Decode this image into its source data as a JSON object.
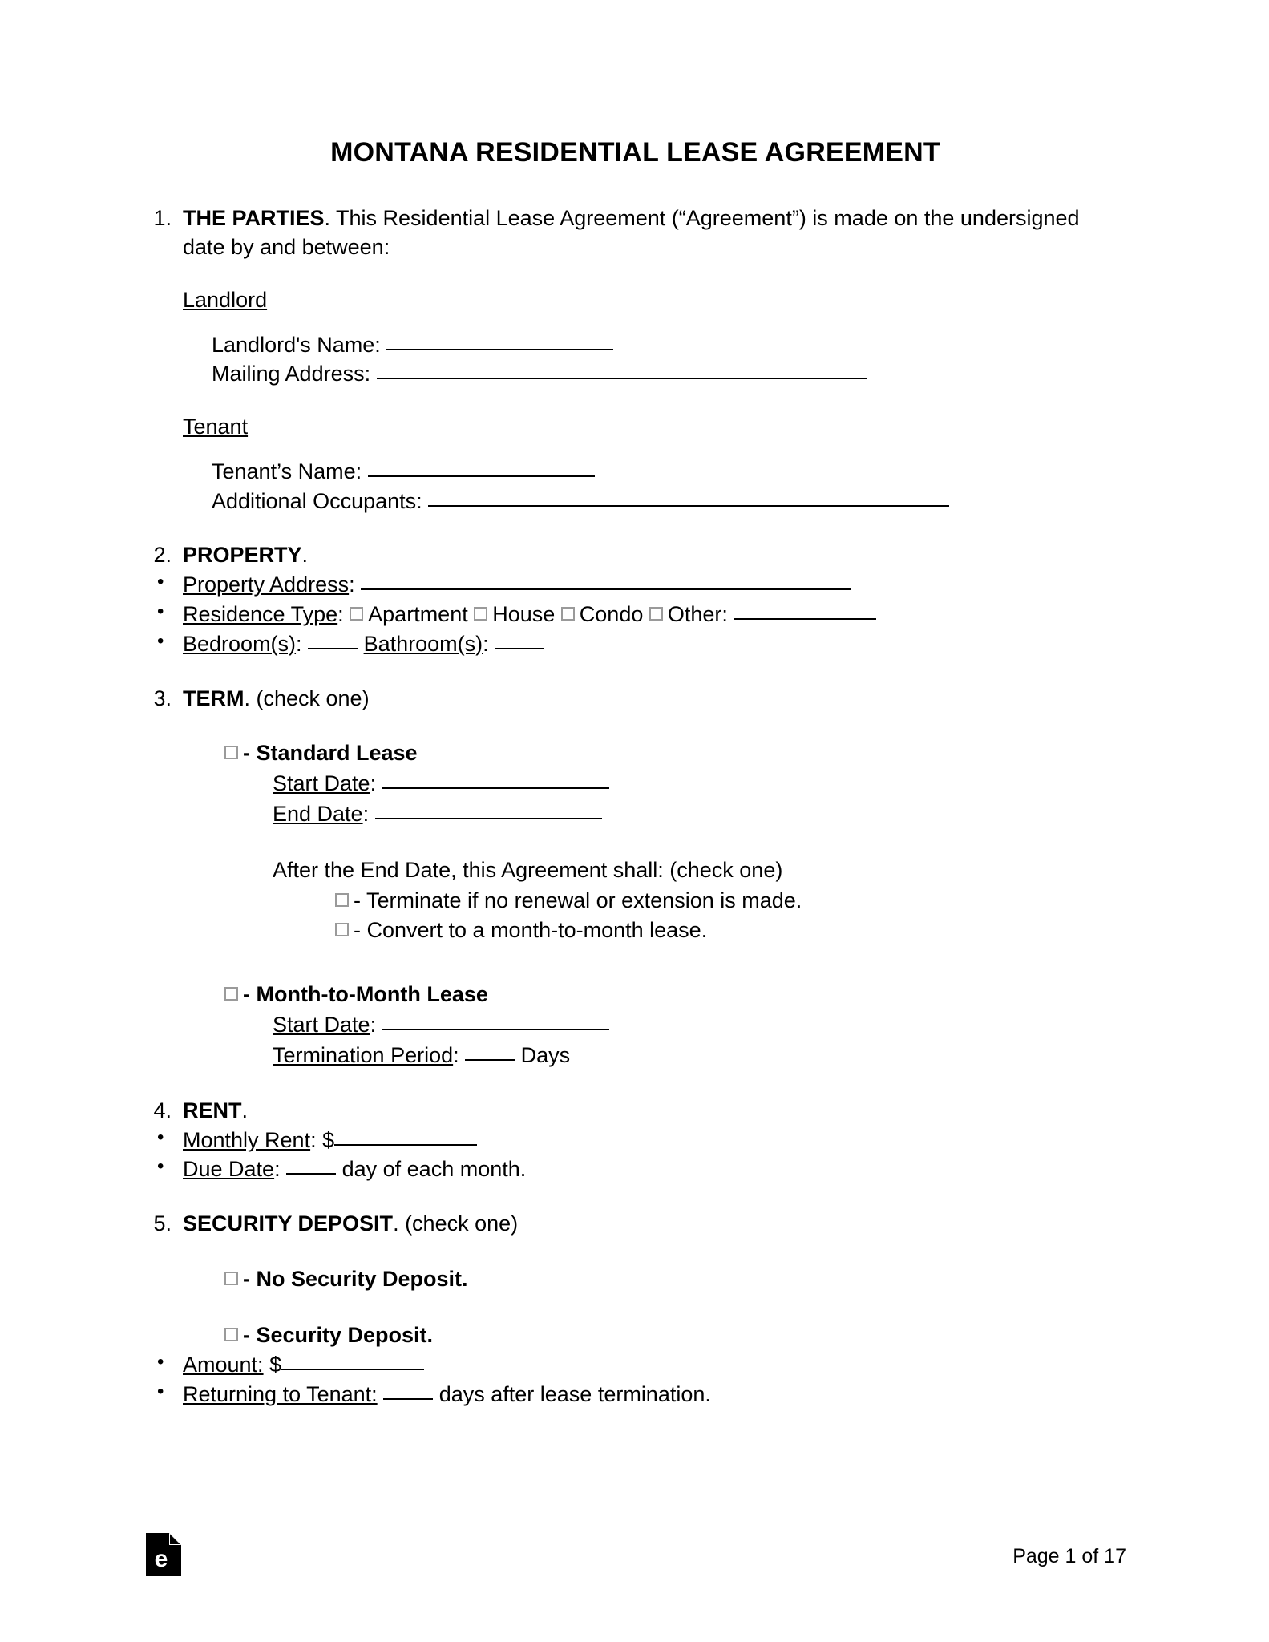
{
  "document": {
    "title": "MONTANA RESIDENTIAL LEASE AGREEMENT"
  },
  "sections": [
    {
      "number": "1.",
      "heading": "THE PARTIES",
      "text": ". This Residential Lease Agreement (“Agreement”) is made on the undersigned date by and between:",
      "landlord_heading": "Landlord",
      "landlord_name_label": "Landlord's Name:",
      "mailing_address_label": "Mailing Address:",
      "tenant_heading": "Tenant",
      "tenant_name_label": "Tenant’s Name:",
      "additional_occupants_label": "Additional Occupants:"
    },
    {
      "number": "2.",
      "heading": "PROPERTY",
      "text": ".",
      "property_address_label": "Property Address",
      "residence_type_label": "Residence Type",
      "residence_options": [
        "Apartment",
        "House",
        "Condo",
        "Other:"
      ],
      "bedrooms_label": "Bedroom(s)",
      "bathrooms_label": "Bathroom(s)"
    },
    {
      "number": "3.",
      "heading": "TERM",
      "text": ". (check one)",
      "standard_lease_label": "- Standard Lease",
      "start_date_label": "Start Date",
      "end_date_label": "End Date",
      "after_end_date_text": "After the End Date, this Agreement shall: (check one)",
      "after_options": [
        "- Terminate if no renewal or extension is made.",
        "- Convert to a month-to-month lease."
      ],
      "month_to_month_label": "- Month-to-Month Lease",
      "mtm_start_date_label": "Start Date",
      "termination_period_label": "Termination Period",
      "days_word": "Days"
    },
    {
      "number": "4.",
      "heading": "RENT",
      "text": ".",
      "monthly_rent_label": "Monthly Rent",
      "monthly_rent_currency": "$",
      "due_date_label": "Due Date",
      "due_date_suffix": "day of each month."
    },
    {
      "number": "5.",
      "heading": "SECURITY DEPOSIT",
      "text": ". (check one)",
      "no_deposit_label": "- No Security Deposit.",
      "deposit_label": "- Security Deposit.",
      "amount_label": "Amount:",
      "amount_currency": "$",
      "returning_label": "Returning to Tenant:",
      "returning_suffix": "days after lease termination."
    }
  ],
  "footer": {
    "logo_letter": "e",
    "page_label": "Page 1 of 17"
  }
}
